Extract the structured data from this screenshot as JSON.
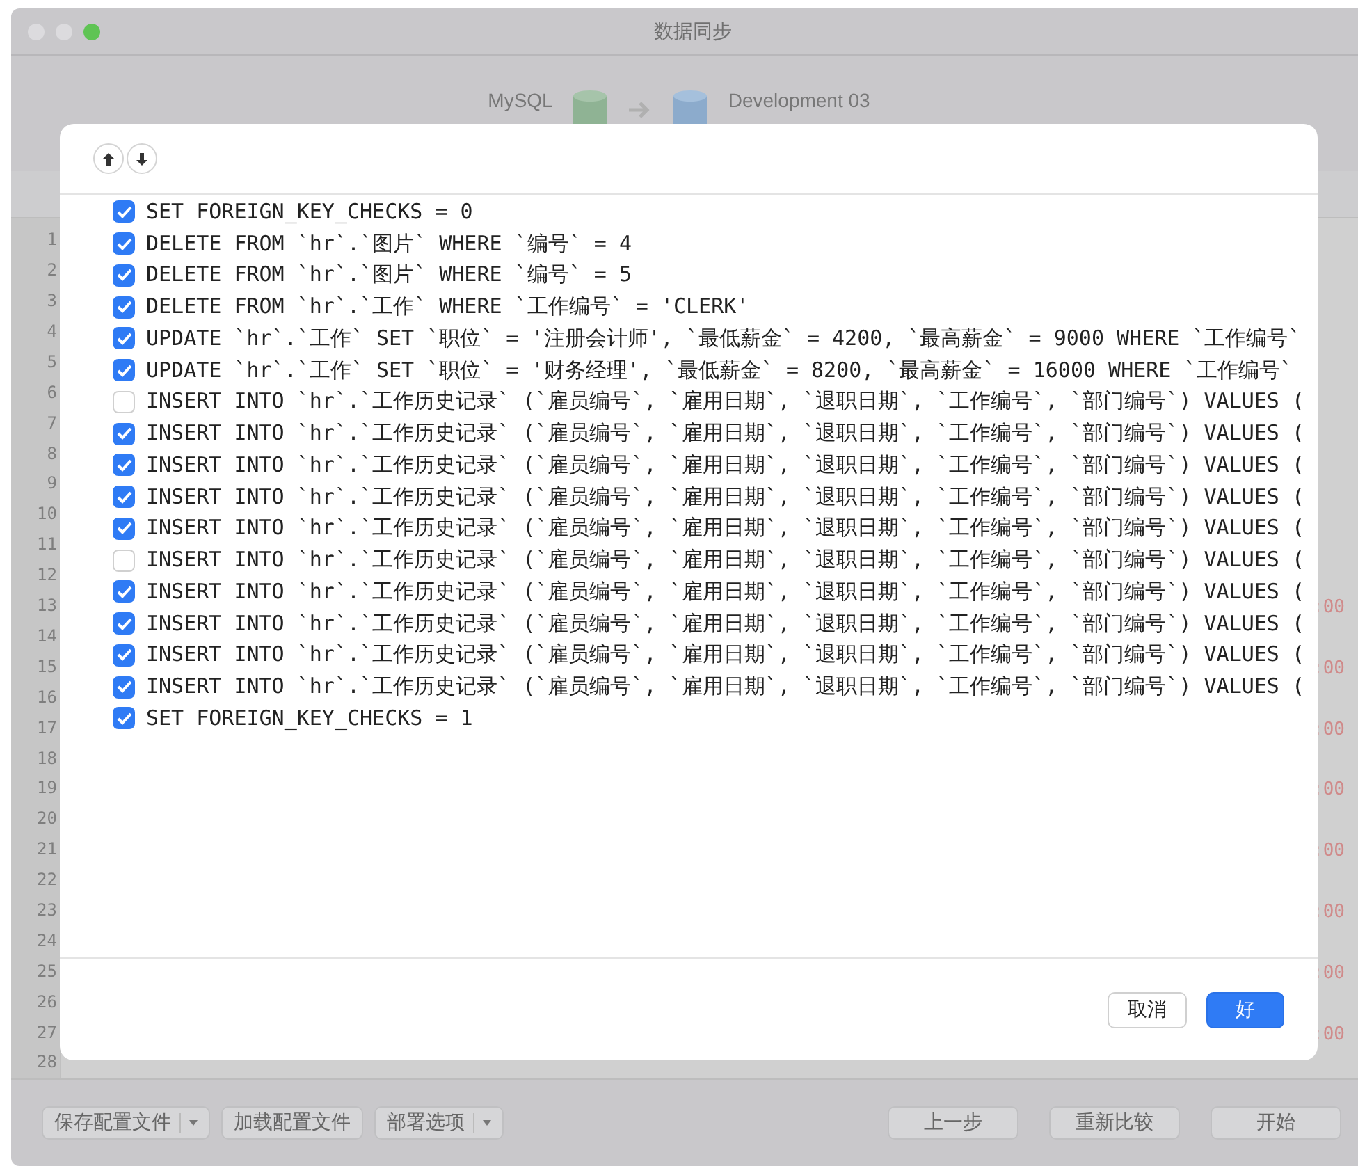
{
  "window": {
    "title": "数据同步"
  },
  "header": {
    "source": "MySQL",
    "target": "Development 03"
  },
  "editor": {
    "lines": [
      {
        "number": "1"
      },
      {
        "number": "2"
      },
      {
        "number": "3"
      },
      {
        "number": "4"
      },
      {
        "number": "5"
      },
      {
        "number": "6"
      },
      {
        "number": "7"
      },
      {
        "number": "8"
      },
      {
        "number": "9"
      },
      {
        "number": "10"
      },
      {
        "number": "11"
      },
      {
        "number": "12"
      },
      {
        "number": "13",
        "tail": ":00"
      },
      {
        "number": "14"
      },
      {
        "number": "15",
        "tail": ":00"
      },
      {
        "number": "16"
      },
      {
        "number": "17",
        "tail": ":00"
      },
      {
        "number": "18"
      },
      {
        "number": "19",
        "tail": ":00"
      },
      {
        "number": "20"
      },
      {
        "number": "21",
        "tail": ":00"
      },
      {
        "number": "22"
      },
      {
        "number": "23",
        "tail": ":00"
      },
      {
        "number": "24"
      },
      {
        "number": "25",
        "tail": ":00"
      },
      {
        "number": "26"
      },
      {
        "number": "27",
        "tail": ":00"
      },
      {
        "number": "28"
      }
    ]
  },
  "dialog": {
    "statements": [
      {
        "text": "SET FOREIGN_KEY_CHECKS = 0",
        "checked": true
      },
      {
        "text": "DELETE FROM `hr`.`图片` WHERE `编号` = 4",
        "checked": true
      },
      {
        "text": "DELETE FROM `hr`.`图片` WHERE `编号` = 5",
        "checked": true
      },
      {
        "text": "DELETE FROM `hr`.`工作` WHERE `工作编号` = 'CLERK'",
        "checked": true
      },
      {
        "text": "UPDATE `hr`.`工作` SET `职位` = '注册会计师', `最低薪金` = 4200, `最高薪金` = 9000 WHERE `工作编号`",
        "checked": true
      },
      {
        "text": "UPDATE `hr`.`工作` SET `职位` = '财务经理', `最低薪金` = 8200, `最高薪金` = 16000 WHERE `工作编号`",
        "checked": true
      },
      {
        "text": "INSERT INTO `hr`.`工作历史记录` (`雇员编号`, `雇用日期`, `退职日期`, `工作编号`, `部门编号`) VALUES (",
        "checked": false
      },
      {
        "text": "INSERT INTO `hr`.`工作历史记录` (`雇员编号`, `雇用日期`, `退职日期`, `工作编号`, `部门编号`) VALUES (",
        "checked": true
      },
      {
        "text": "INSERT INTO `hr`.`工作历史记录` (`雇员编号`, `雇用日期`, `退职日期`, `工作编号`, `部门编号`) VALUES (",
        "checked": true
      },
      {
        "text": "INSERT INTO `hr`.`工作历史记录` (`雇员编号`, `雇用日期`, `退职日期`, `工作编号`, `部门编号`) VALUES (",
        "checked": true
      },
      {
        "text": "INSERT INTO `hr`.`工作历史记录` (`雇员编号`, `雇用日期`, `退职日期`, `工作编号`, `部门编号`) VALUES (",
        "checked": true
      },
      {
        "text": "INSERT INTO `hr`.`工作历史记录` (`雇员编号`, `雇用日期`, `退职日期`, `工作编号`, `部门编号`) VALUES (",
        "checked": false
      },
      {
        "text": "INSERT INTO `hr`.`工作历史记录` (`雇员编号`, `雇用日期`, `退职日期`, `工作编号`, `部门编号`) VALUES (",
        "checked": true
      },
      {
        "text": "INSERT INTO `hr`.`工作历史记录` (`雇员编号`, `雇用日期`, `退职日期`, `工作编号`, `部门编号`) VALUES (",
        "checked": true
      },
      {
        "text": "INSERT INTO `hr`.`工作历史记录` (`雇员编号`, `雇用日期`, `退职日期`, `工作编号`, `部门编号`) VALUES (",
        "checked": true
      },
      {
        "text": "INSERT INTO `hr`.`工作历史记录` (`雇员编号`, `雇用日期`, `退职日期`, `工作编号`, `部门编号`) VALUES (",
        "checked": true
      },
      {
        "text": "SET FOREIGN_KEY_CHECKS = 1",
        "checked": true
      }
    ],
    "buttons": [
      {
        "label": "取消",
        "kind": "secondary"
      },
      {
        "label": "好",
        "kind": "primary"
      }
    ]
  },
  "bottom_bar": {
    "left_buttons": [
      {
        "label": "保存配置文件",
        "has_menu": true
      },
      {
        "label": "加载配置文件",
        "has_menu": false
      },
      {
        "label": "部署选项",
        "has_menu": true
      }
    ],
    "right_buttons": [
      {
        "label": "上一步"
      },
      {
        "label": "重新比较"
      },
      {
        "label": "开始"
      }
    ]
  }
}
